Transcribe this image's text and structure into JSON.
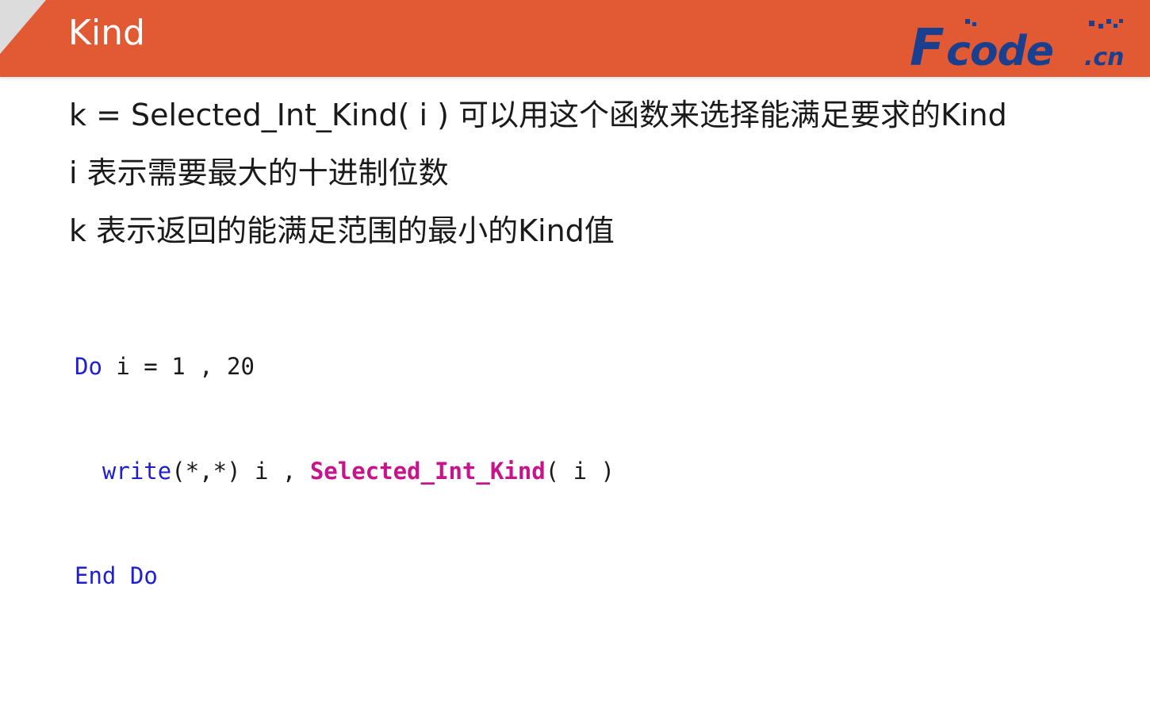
{
  "header": {
    "title": "Kind",
    "logo_text": "Fcode.cn",
    "accent_color": "#e25a33",
    "logo_color": "#1a3f8e"
  },
  "bullets": [
    "k = Selected_Int_Kind( i )  可以用这个函数来选择能满足要求的Kind",
    "i 表示需要最大的十进制位数",
    "k 表示返回的能满足范围的最小的Kind值"
  ],
  "code": {
    "line1": {
      "kw_do": "Do",
      "rest": " i = 1 , 20"
    },
    "line2": {
      "indent": "  ",
      "kw_write": "write",
      "rest": "(*,*) i , ",
      "fn_name": "Selected_Int_Kind",
      "args": "( i )"
    },
    "line3": {
      "kw_end": "End",
      "sep": " ",
      "kw_do": "Do"
    },
    "keyword_color": "#1f1fd0",
    "function_color": "#c8148c"
  }
}
